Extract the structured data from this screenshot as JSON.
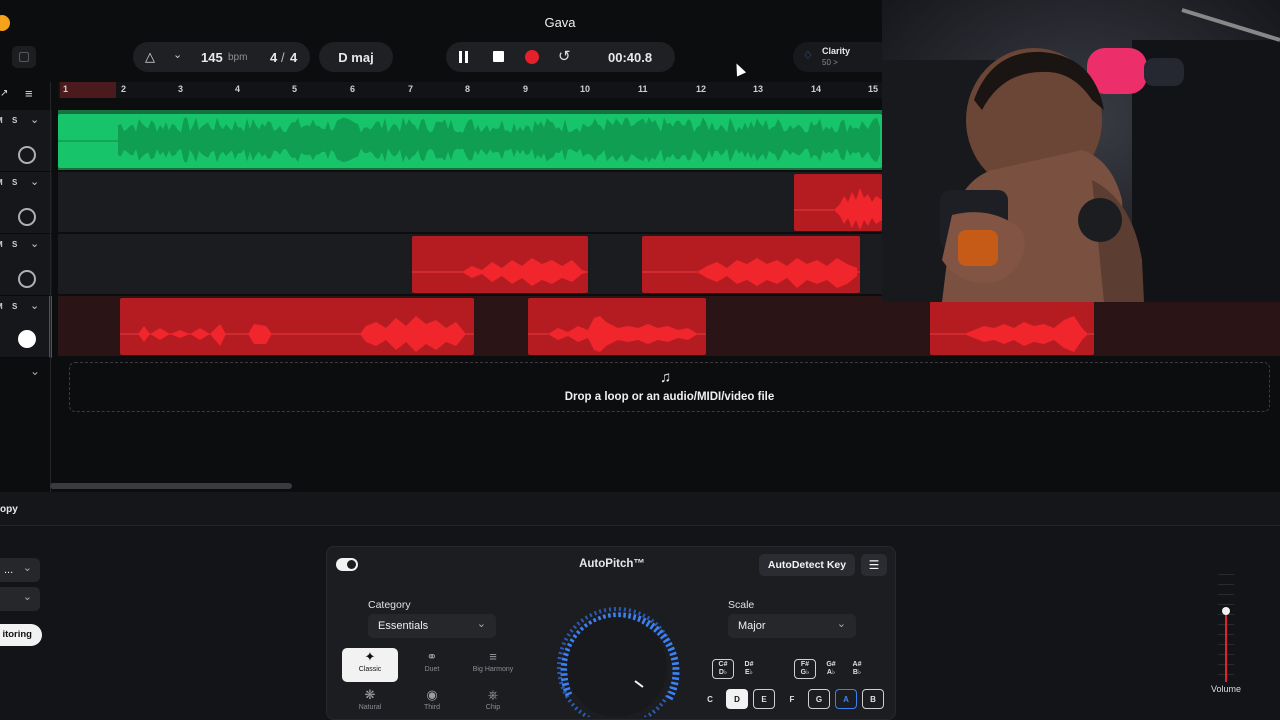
{
  "project": {
    "title": "Gava"
  },
  "transport": {
    "bpm_value": "145",
    "bpm_unit": "bpm",
    "time_sig_num": "4",
    "time_sig_sep": "/",
    "time_sig_den": "4",
    "key": "D maj",
    "time": "00:40.8",
    "record_color": "#e5202b"
  },
  "clarity": {
    "label": "Clarity",
    "value": "50 >"
  },
  "ruler": {
    "bars": [
      "1",
      "2",
      "3",
      "4",
      "5",
      "6",
      "7",
      "8",
      "9",
      "10",
      "11",
      "12",
      "13",
      "14",
      "15"
    ]
  },
  "tracks": [
    {
      "mute": "M",
      "solo": "S",
      "color": "#18c46a"
    },
    {
      "mute": "M",
      "solo": "S",
      "color": "#c91f24"
    },
    {
      "mute": "M",
      "solo": "S",
      "color": "#c91f24"
    },
    {
      "mute": "M",
      "solo": "S",
      "color": "#c91f24"
    }
  ],
  "dropzone": {
    "text": "Drop a loop or an audio/MIDI/video file"
  },
  "left_panel": {
    "title": "opy",
    "select1": "...",
    "monitoring_button": "itoring"
  },
  "autopitch": {
    "title": "AutoPitch™",
    "autodetect_label": "AutoDetect Key",
    "category_label": "Category",
    "category_value": "Essentials",
    "categories": [
      "Classic",
      "Duet",
      "Big Harmony",
      "Natural",
      "Third",
      "Chip"
    ],
    "scale_label": "Scale",
    "scale_value": "Major",
    "sharps": [
      "C#",
      "D♭",
      "D#",
      "E♭",
      "F#",
      "G♭",
      "G#",
      "A♭",
      "A#",
      "B♭"
    ],
    "naturals": [
      "C",
      "D",
      "E",
      "F",
      "G",
      "A",
      "B"
    ]
  },
  "volume": {
    "label": "Volume"
  },
  "colors": {
    "accent_blue": "#3b82f6",
    "green": "#18c46a",
    "red": "#c91f24",
    "bg": "#0c0d0f"
  }
}
